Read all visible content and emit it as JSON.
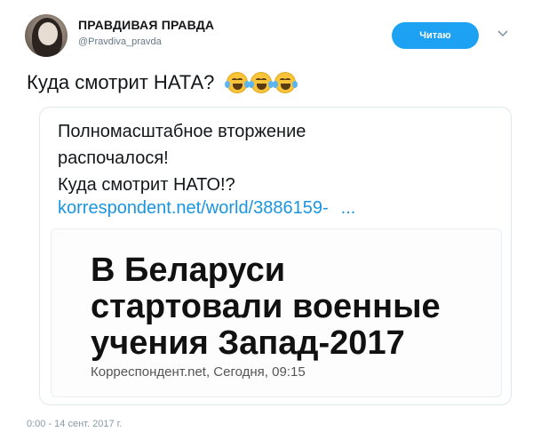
{
  "header": {
    "display_name": "ПРАВДИВАЯ ПРАВДА",
    "handle": "@Pravdiva_pravda",
    "follow_label": "Читаю",
    "caret": "⌄"
  },
  "tweet": {
    "text": "Куда смотрит НАТА?",
    "emojis": [
      "face-with-tears-of-joy-icon",
      "face-with-tears-of-joy-icon",
      "face-with-tears-of-joy-icon"
    ],
    "timestamp": "0:00 - 14 сент. 2017 г."
  },
  "quote": {
    "line1": "Полномасштабное вторжение",
    "line2": "распочалося!",
    "line3": "Куда смотрит НАТО!?",
    "link": "korrespondent.net/world/3886159-",
    "link_ellipsis": "..."
  },
  "card": {
    "headline_line1": "В Беларуси",
    "headline_line2": "стартовали военные",
    "headline_line3": "учения Запад-2017",
    "source": "Корреспондент.net, Сегодня, 09:15"
  },
  "colors": {
    "accent": "#1da1f2",
    "link": "#1b95e0",
    "muted": "#657786"
  }
}
